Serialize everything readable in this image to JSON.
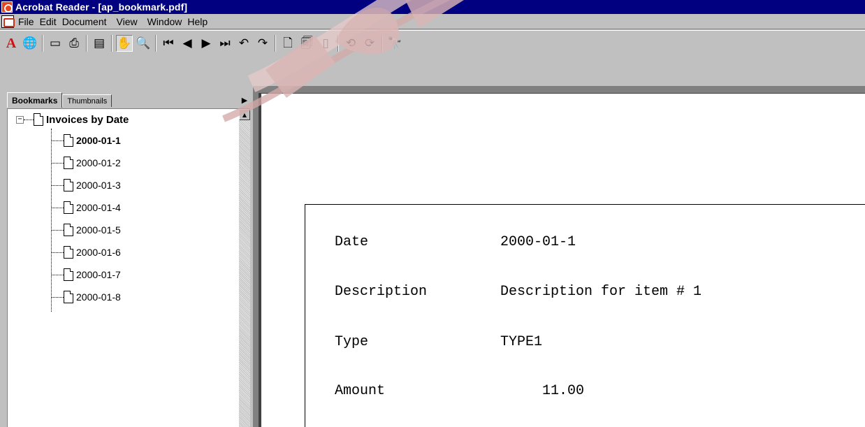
{
  "window": {
    "title": "Acrobat Reader - [ap_bookmark.pdf]"
  },
  "menu": {
    "items": [
      "File",
      "Edit",
      "Document",
      "View",
      "Window",
      "Help"
    ]
  },
  "toolbar": {
    "icons": [
      "adobe-logo",
      "globe",
      "open-folder",
      "print",
      "show-hide-navigation",
      "hand-tool",
      "zoom-in-tool",
      "first-page",
      "previous-page",
      "next-page",
      "last-page",
      "go-back",
      "actual-size",
      "fit-page",
      "fit-width",
      "rotate-left",
      "rotate-right",
      "find"
    ]
  },
  "panel": {
    "tabs": [
      "Bookmarks",
      "Thumbnails"
    ],
    "active_tab": "Bookmarks"
  },
  "bookmarks": {
    "root": "Invoices by Date",
    "children": [
      "2000-01-1",
      "2000-01-2",
      "2000-01-3",
      "2000-01-4",
      "2000-01-5",
      "2000-01-6",
      "2000-01-7",
      "2000-01-8"
    ],
    "selected": "2000-01-1"
  },
  "document": {
    "rows": [
      {
        "label": "Date",
        "value": "2000-01-1"
      },
      {
        "label": "Description",
        "value": "Description for item # 1"
      },
      {
        "label": "Type",
        "value": "TYPE1"
      },
      {
        "label": "Amount",
        "value": "     11.00"
      }
    ]
  },
  "colors": {
    "titlebar": "#000080",
    "chrome": "#c0c0c0",
    "stamp": "#c88c8c"
  }
}
